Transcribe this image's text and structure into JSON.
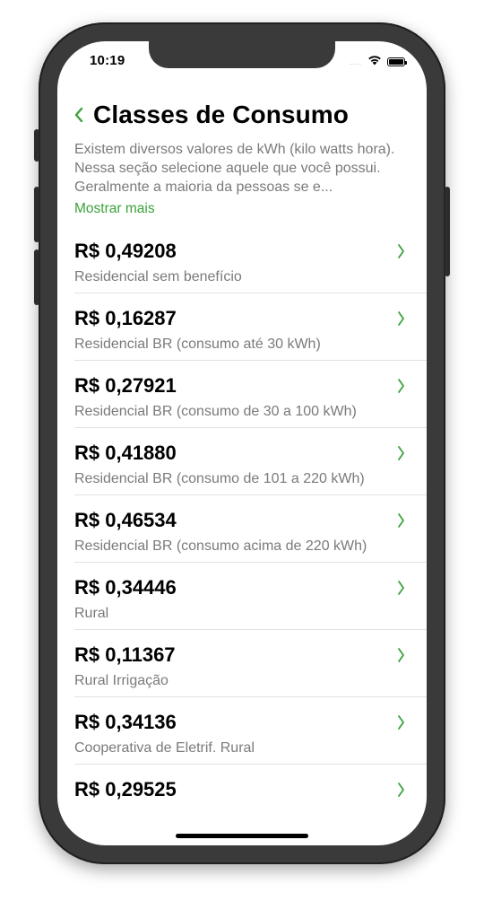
{
  "status_bar": {
    "time": "10:19",
    "signal": "....",
    "wifi_icon": "wifi-icon",
    "battery_icon": "battery-icon"
  },
  "header": {
    "back_icon": "chevron-left-icon",
    "title": "Classes de Consumo"
  },
  "description": {
    "text": "Existem diversos valores de kWh (kilo watts hora). Nessa seção selecione aquele que você possui. Geralmente a maioria da pessoas se e...",
    "show_more": "Mostrar mais"
  },
  "colors": {
    "accent": "#3ba23b",
    "secondary_text": "#7a7a7a",
    "primary_text": "#000000"
  },
  "items": [
    {
      "price": "R$ 0,49208",
      "label": "Residencial sem benefício"
    },
    {
      "price": "R$ 0,16287",
      "label": "Residencial BR (consumo até 30 kWh)"
    },
    {
      "price": "R$ 0,27921",
      "label": "Residencial BR (consumo de 30 a 100 kWh)"
    },
    {
      "price": "R$ 0,41880",
      "label": "Residencial BR (consumo de 101 a 220 kWh)"
    },
    {
      "price": "R$ 0,46534",
      "label": "Residencial BR (consumo acima de 220 kWh)"
    },
    {
      "price": "R$ 0,34446",
      "label": "Rural"
    },
    {
      "price": "R$ 0,11367",
      "label": "Rural Irrigação"
    },
    {
      "price": "R$ 0,34136",
      "label": "Cooperativa de Eletrif. Rural"
    },
    {
      "price": "R$ 0,29525",
      "label": ""
    }
  ]
}
